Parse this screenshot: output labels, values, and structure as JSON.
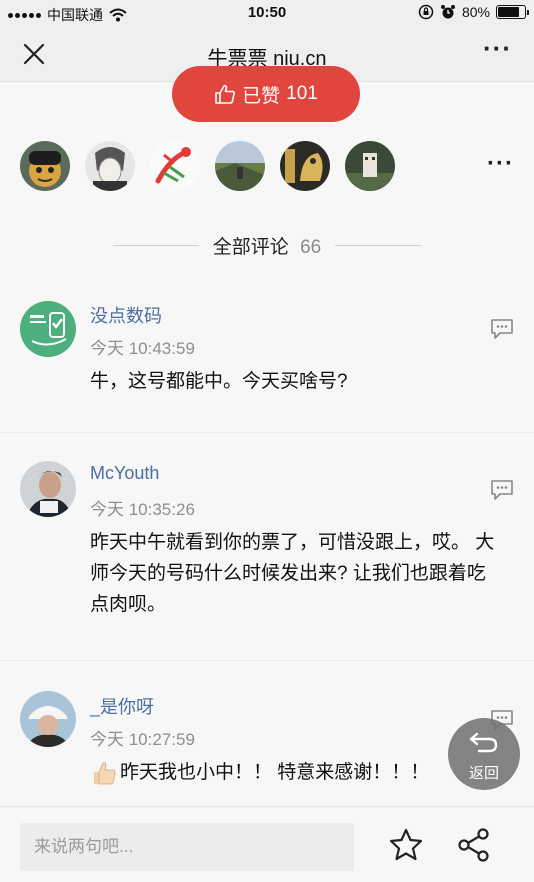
{
  "status_bar": {
    "carrier": "中国联通",
    "time": "10:50",
    "battery": "80%",
    "battery_level": 0.8,
    "icons": [
      "signal-icon",
      "wifi-icon",
      "orientation-lock-icon",
      "alarm-icon",
      "battery-icon"
    ]
  },
  "nav": {
    "title": "牛票票 niu.cn",
    "close_icon": "close-icon",
    "more_icon": "more-icon"
  },
  "like": {
    "label": "已赞",
    "count": "101",
    "icon": "thumbs-up-icon",
    "color": "#e0463d"
  },
  "avatars": {
    "items": [
      "avatar-1",
      "avatar-2",
      "avatar-3",
      "avatar-4",
      "avatar-5",
      "avatar-6"
    ],
    "more_icon": "more-icon"
  },
  "comments_section": {
    "title": "全部评论",
    "count": "66"
  },
  "comments": [
    {
      "name": "没点数码",
      "time": "今天 10:43:59",
      "text": "牛，这号都能中。今天买啥号?"
    },
    {
      "name": "McYouth",
      "time": "今天 10:35:26",
      "text": "昨天中午就看到你的票了，可惜没跟上，哎。 大师今天的号码什么时候发出来? 让我们也跟着吃点肉呗。"
    },
    {
      "name": "_是你呀",
      "time": "今天 10:27:59",
      "text": "昨天我也小中！！ 特意来感谢！！！"
    }
  ],
  "floating_back": {
    "label": "返回",
    "icon": "undo-arrow-icon"
  },
  "bottom_bar": {
    "input_placeholder": "来说两句吧...",
    "star_icon": "star-icon",
    "share_icon": "share-icon"
  },
  "colors": {
    "accent_red": "#e0463d",
    "link_blue": "#4a6fa5",
    "muted_gray": "#8e8e8e"
  }
}
